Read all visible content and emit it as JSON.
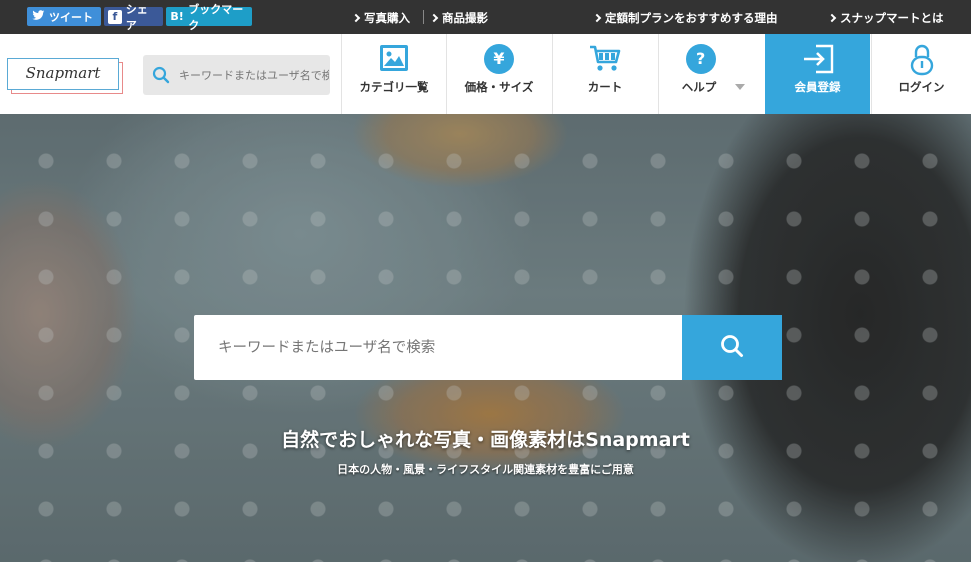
{
  "social": {
    "tweet": "ツイート",
    "share": "シェア",
    "bookmark": "ブックマーク",
    "bookmark_mark": "B!",
    "fb_mark": "f"
  },
  "toplinks": [
    "写真購入",
    "商品撮影",
    "定額制プランをおすすめする理由",
    "スナップマートとは"
  ],
  "logo": {
    "text": "Snapmart"
  },
  "header_search": {
    "placeholder": "キーワードまたはユーザ名で検索"
  },
  "nav": {
    "category": "カテゴリ一覧",
    "price": "価格・サイズ",
    "price_symbol": "¥",
    "cart": "カート",
    "help": "ヘルプ",
    "help_symbol": "?",
    "signup": "会員登録",
    "login": "ログイン"
  },
  "hero": {
    "search_placeholder": "キーワードまたはユーザ名で検索",
    "tagline": "自然でおしゃれな写真・画像素材はSnapmart",
    "subtagline": "日本の人物・風景・ライフスタイル関連素材を豊富にご用意"
  },
  "colors": {
    "accent": "#35a6dc",
    "topbar": "#333333",
    "twitter": "#3f8fd9",
    "facebook": "#3b5998",
    "hatena": "#1e9ec8"
  },
  "icons": [
    "twitter-icon",
    "facebook-icon",
    "hatena-icon",
    "chevron-right-icon",
    "search-icon",
    "image-icon",
    "yen-icon",
    "cart-icon",
    "help-icon",
    "chevron-down-icon",
    "signup-icon",
    "lock-icon"
  ]
}
